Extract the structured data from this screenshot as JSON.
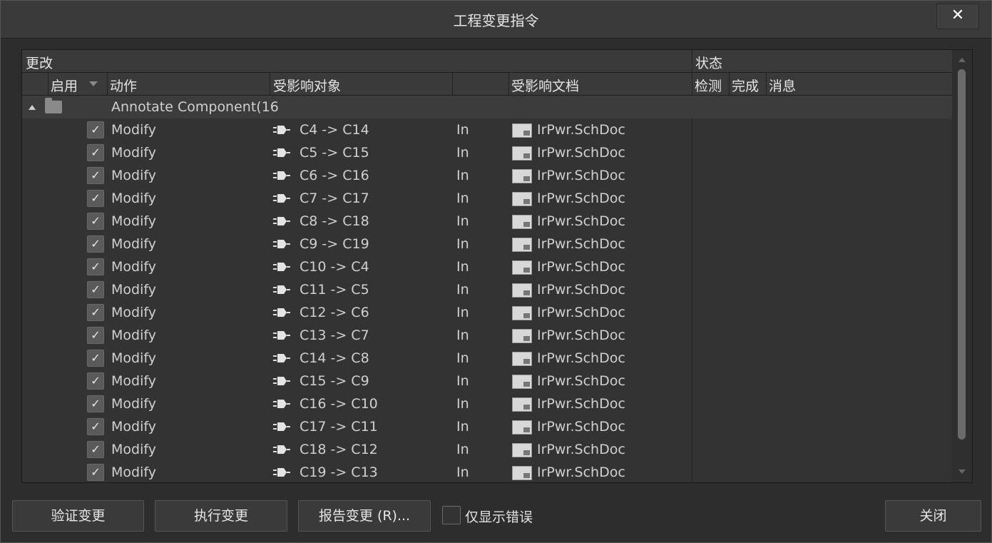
{
  "window": {
    "title": "工程变更指令",
    "close_glyph": "✕"
  },
  "table": {
    "group_header_changes": "更改",
    "group_header_status": "状态",
    "columns": {
      "enable": "启用",
      "action": "动作",
      "affected_object": "受影响对象",
      "direction": "",
      "affected_document": "受影响文档",
      "check": "检测",
      "done": "完成",
      "message": "消息"
    },
    "group_row": {
      "label": "Annotate Component(16"
    },
    "rows": [
      {
        "action": "Modify",
        "object": "C4 -> C14",
        "dir": "In",
        "doc": "IrPwr.SchDoc"
      },
      {
        "action": "Modify",
        "object": "C5 -> C15",
        "dir": "In",
        "doc": "IrPwr.SchDoc"
      },
      {
        "action": "Modify",
        "object": "C6 -> C16",
        "dir": "In",
        "doc": "IrPwr.SchDoc"
      },
      {
        "action": "Modify",
        "object": "C7 -> C17",
        "dir": "In",
        "doc": "IrPwr.SchDoc"
      },
      {
        "action": "Modify",
        "object": "C8 -> C18",
        "dir": "In",
        "doc": "IrPwr.SchDoc"
      },
      {
        "action": "Modify",
        "object": "C9 -> C19",
        "dir": "In",
        "doc": "IrPwr.SchDoc"
      },
      {
        "action": "Modify",
        "object": "C10 -> C4",
        "dir": "In",
        "doc": "IrPwr.SchDoc"
      },
      {
        "action": "Modify",
        "object": "C11 -> C5",
        "dir": "In",
        "doc": "IrPwr.SchDoc"
      },
      {
        "action": "Modify",
        "object": "C12 -> C6",
        "dir": "In",
        "doc": "IrPwr.SchDoc"
      },
      {
        "action": "Modify",
        "object": "C13 -> C7",
        "dir": "In",
        "doc": "IrPwr.SchDoc"
      },
      {
        "action": "Modify",
        "object": "C14 -> C8",
        "dir": "In",
        "doc": "IrPwr.SchDoc"
      },
      {
        "action": "Modify",
        "object": "C15 -> C9",
        "dir": "In",
        "doc": "IrPwr.SchDoc"
      },
      {
        "action": "Modify",
        "object": "C16 -> C10",
        "dir": "In",
        "doc": "IrPwr.SchDoc"
      },
      {
        "action": "Modify",
        "object": "C17 -> C11",
        "dir": "In",
        "doc": "IrPwr.SchDoc"
      },
      {
        "action": "Modify",
        "object": "C18 -> C12",
        "dir": "In",
        "doc": "IrPwr.SchDoc"
      },
      {
        "action": "Modify",
        "object": "C19 -> C13",
        "dir": "In",
        "doc": "IrPwr.SchDoc"
      }
    ],
    "check_glyph": "✓"
  },
  "footer": {
    "validate_label": "验证变更",
    "execute_label": "执行变更",
    "report_label": "报告变更 (R)...",
    "only_errors_label": "仅显示错误",
    "only_errors_checked": false,
    "close_label": "关闭"
  },
  "icons": {
    "close": "close-icon",
    "sort": "sort-down-icon",
    "expander": "collapse-triangle-icon",
    "folder": "folder-icon",
    "component": "component-icon",
    "document": "schematic-document-icon",
    "check": "checkmark-icon"
  }
}
